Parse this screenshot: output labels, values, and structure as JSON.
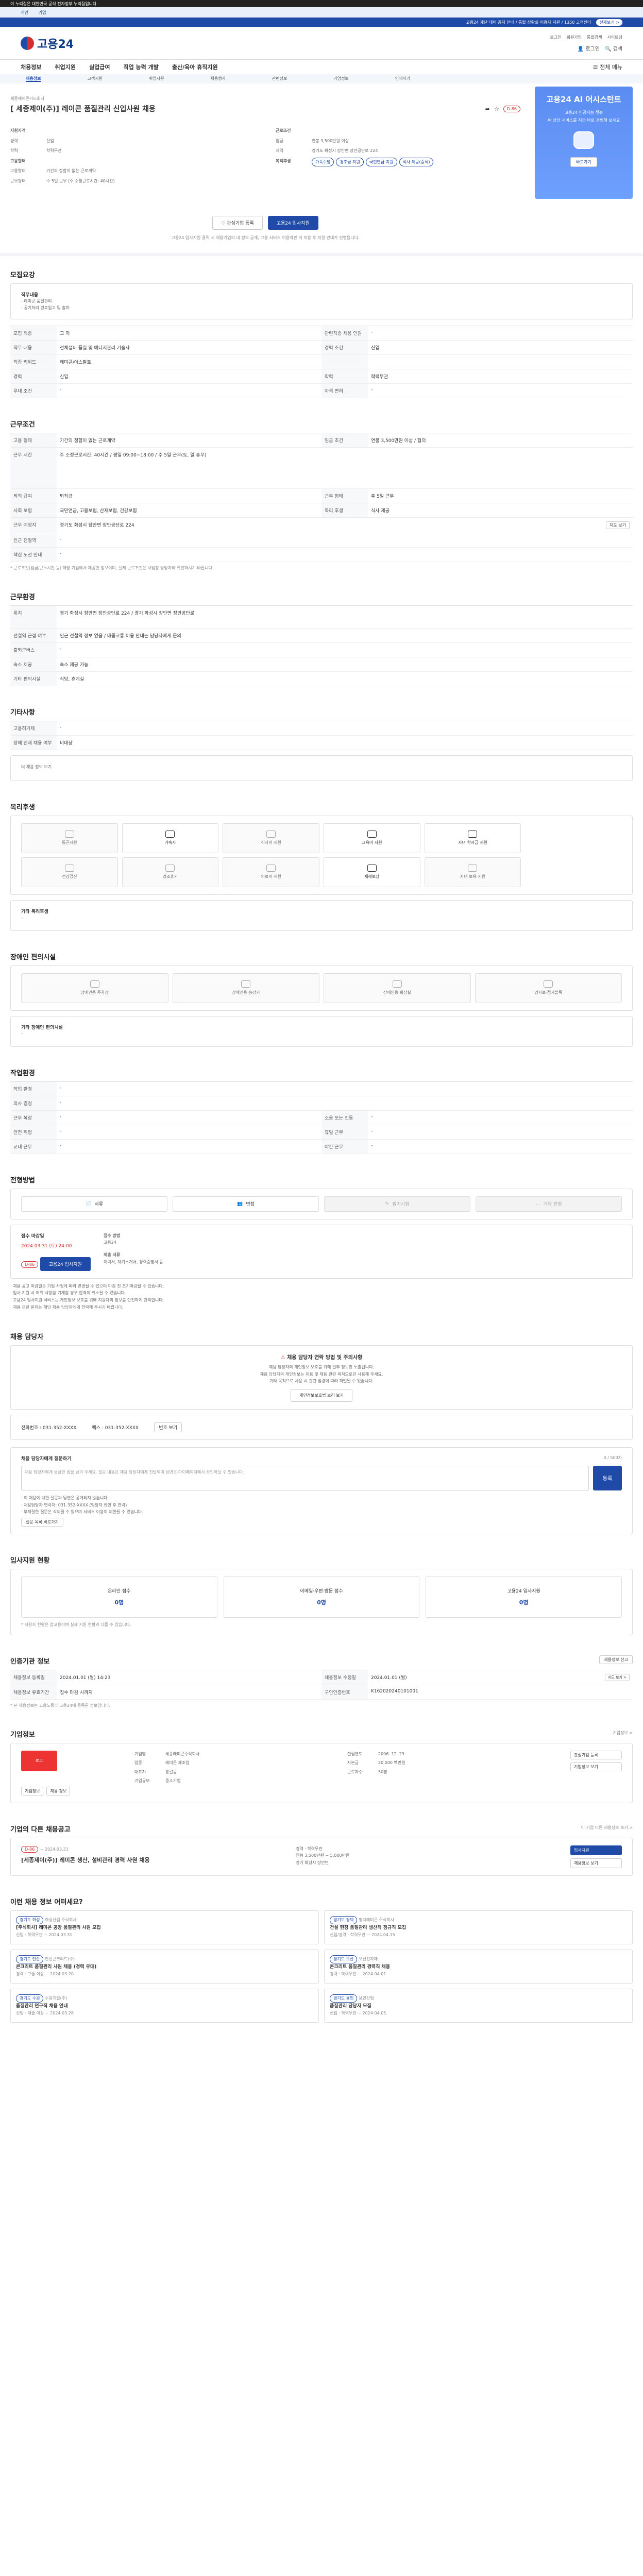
{
  "topbar": {
    "text": "이 누리집은 대한민국 공식 전자정부 누리집입니다."
  },
  "gov_links": [
    "개인",
    "기업"
  ],
  "alert": {
    "text": "고용24 재난 대비 공지 안내 / 통합 상황실 이용자 지원 / 1350 고객센터",
    "btn": "전체보기 >"
  },
  "header": {
    "logo": "고용24",
    "util": [
      "로그인",
      "회원가입",
      "통합검색",
      "사이트맵"
    ],
    "login": "로그인",
    "search": "검색"
  },
  "gnb": {
    "items": [
      "채용정보",
      "취업지원",
      "실업급여",
      "직업 능력 개발",
      "출산/육아 휴직지원"
    ],
    "right": "전체 메뉴"
  },
  "subnav": {
    "items": [
      "채용정보",
      "고객지원",
      "취업지원",
      "채용행사",
      "관련정보",
      "기업정보",
      "인쇄하기"
    ]
  },
  "job": {
    "company": "세종에이콘카드회사",
    "title": "[ 세종제이(주)] 레이콘 품질관리 신입사원 채용",
    "dday": "D-86",
    "meta_left": [
      {
        "k": "지원자격",
        "v": ""
      },
      {
        "k": "경력",
        "v": "신입"
      },
      {
        "k": "학력",
        "v": "학력무관"
      },
      {
        "k": "고용형태",
        "v": ""
      },
      {
        "k": "고용형태",
        "v": "기간의 정함이 없는 근로계약"
      },
      {
        "k": "근무형태",
        "v": "주 5일 근무 (주 소정근로시간: 40시간)"
      }
    ],
    "meta_right": [
      {
        "k": "근로조건",
        "v": ""
      },
      {
        "k": "임금",
        "v": "연봉 3,500만원 이상"
      },
      {
        "k": "지역",
        "v": "경기도 화성시 장안면 장안공단로 224"
      },
      {
        "k": "복리후생",
        "v": ""
      }
    ],
    "welfare_tags": [
      "가족수당",
      "경조금 지원",
      "국민연금 지원",
      "식사 제공(중식)"
    ],
    "btn_interest": "관심기업 등록",
    "btn_apply": "고용24 입사지원",
    "apply_note": "고용24 입사지원 클릭 시 채용기업의 내 정보 공개, 고용 서비스 이용약관 이 적용 후 지원 안내가 진행됩니다."
  },
  "side_banner": {
    "title": "고용24 AI 어시스턴트",
    "line1": "고용24 인공지능 챗봇",
    "line2": "AI 상담 서비스를 지금 바로 경험해 보세요",
    "btn": "바로가기"
  },
  "recruit": {
    "heading": "모집요강",
    "duty_title": "직무내용",
    "duties": [
      "- 레미콘 품질관리",
      "- 공기처리 원료입고 및 출하"
    ],
    "rows": [
      [
        "모집 직종",
        "그 외",
        "관련직종 채용 인원",
        "-"
      ],
      [
        "직무 내용",
        "전체설비 품질 및 에너지관리 기술사",
        "경력 조건",
        "신입"
      ],
      [
        "직종 키워드",
        "레미콘/아스팔트",
        "",
        ""
      ],
      [
        "경력",
        "신입",
        "학력",
        "학력무관"
      ],
      [
        "우대 조건",
        "-",
        "자격 면허",
        "-"
      ]
    ]
  },
  "workcond": {
    "heading": "근무조건",
    "rows": [
      [
        "고용 형태",
        "기간의 정함이 없는 근로계약",
        "임금 조건",
        "연봉 3,500만원 이상 / 협의"
      ],
      [
        "근무 시간",
        "주 소정근로시간: 40시간 / 평일 09:00~18:00 / 주 5일 근무(토, 일 휴무)",
        "",
        ""
      ],
      [
        "퇴직 급여",
        "퇴직금",
        "근무 형태",
        "주 5일 근무"
      ],
      [
        "사회 보험",
        "국민연금, 고용보험, 산재보험, 건강보험",
        "복리 후생",
        "식사 제공"
      ],
      [
        "근무 예정지",
        "경기도 화성시 장안면 장안공단로 224",
        "",
        ""
      ],
      [
        "인근 전철역",
        "-",
        "",
        ""
      ],
      [
        "핵심 노선 안내",
        "-",
        "",
        ""
      ]
    ],
    "note": "* 근로조건(임금/근무시간 등) 해당 기업에서 제공한 정보이며, 실제 근로조건은 사업장 담당자와 확인하시기 바랍니다.",
    "map_btn": "지도 보기"
  },
  "location": {
    "heading": "근무환경",
    "rows": [
      [
        "위치",
        "경기 화성시 장안면 장안공단로 224 / 경기 화성시 장안면 장안공단로"
      ],
      [
        "전철역 근접 여부",
        "인근 전철역 정보 없음 / 대중교통 이용 안내는 담당자에게 문의"
      ],
      [
        "출퇴근버스",
        "-"
      ],
      [
        "숙소 제공",
        "숙소 제공 가능"
      ],
      [
        "기타 편의시설",
        "식당, 휴게실"
      ]
    ]
  },
  "etc": {
    "heading": "기타사항",
    "rows": [
      [
        "고용허가제",
        "-"
      ],
      [
        "장애 인재 채용 여부",
        "비대상"
      ]
    ],
    "link": "더 채용 정보 보기"
  },
  "welfare_sec": {
    "heading": "복리후생",
    "items": [
      "통근지원",
      "기숙사",
      "식사비 지원",
      "교육비 지원",
      "자녀 학자금 지원",
      "건강검진",
      "경조휴가",
      "의료비 지원",
      "재해보상",
      "자녀 보육 지원"
    ],
    "other_title": "기타 복리후생",
    "other_value": "-"
  },
  "accessibility": {
    "heading": "장애인 편의시설",
    "items": [
      "장애인용 주차장",
      "장애인용 승강기",
      "장애인용 화장실",
      "경사로·점자블록"
    ],
    "other_title": "기타 장애인 편의시설",
    "other_value": "-"
  },
  "workplace": {
    "heading": "작업환경",
    "rows": [
      [
        "작업 환경",
        "-",
        "",
        ""
      ],
      [
        "의사 결정",
        "-",
        "",
        ""
      ],
      [
        "근무 복장",
        "-",
        "소음 또는 진동",
        "-"
      ],
      [
        "안전 위험",
        "-",
        "휴일 근무",
        "-"
      ],
      [
        "교대 근무",
        "-",
        "야간 근무",
        "-"
      ]
    ]
  },
  "process": {
    "heading": "전형방법",
    "steps": [
      "서류",
      "면접",
      "필기시험",
      "기타 전형"
    ],
    "apply_dead_title": "접수 마감일",
    "apply_dead": "2024.03.31 (토) 24:00",
    "dday": "D-86",
    "method_title": "접수 방법",
    "method": "고용24",
    "doc_title": "제출 서류",
    "doc": "이력서, 자기소개서, 경력증명서 등",
    "btn_apply": "고용24 입사지원",
    "notes": [
      "· 채용 공고 마감일은 기업 사정에 따라 변경될 수 있으며 마감 전 조기마감될 수 있습니다.",
      "· 입사 지원 시 허위 사항을 기재할 경우 합격이 취소될 수 있습니다.",
      "· 고용24 입사지원 서비스는 개인정보 보호를 위해 지원자의 정보를 안전하게 관리합니다.",
      "· 채용 관련 문의는 해당 채용 담당자에게 연락해 주시기 바랍니다."
    ]
  },
  "contact": {
    "heading": "채용 담당자",
    "warn_title": "채용 담당자 연락 방법 및 주의사항",
    "warn_lines": [
      "채용 담당자의 개인정보 보호를 위해 일부 정보만 노출됩니다.",
      "채용 담당자의 개인정보는 채용 및 채용 관련 목적으로만 사용해 주세요.",
      "기타 목적으로 사용 시 관련 법령에 따라 처벌될 수 있습니다."
    ],
    "warn_btn": "개인정보보호법 보러 보기",
    "phone_label": "전화번호 : 031-352-XXXX",
    "fax_label": "팩스 : 031-352-XXXX",
    "phone_btn": "번호 보기",
    "inquiry_title": "채용 담당자에게 질문하기",
    "inquiry_placeholder": "채용 담당자에게 궁금한 점을 남겨 주세요. 질문 내용은 채용 담당자에게 전달되며 답변은 마이페이지에서 확인하실 수 있습니다.",
    "inquiry_count": "0 / 500자",
    "inquiry_btn": "등록",
    "inquiry_notes": [
      "· 이 채용에 대한 질문과 답변은 공개되지 않습니다.",
      "· 채용담당자 연락처: 031-352-XXXX (담당자 확인 후 연락)",
      "· 부적절한 질문은 삭제될 수 있으며 서비스 이용이 제한될 수 있습니다."
    ],
    "inquiry_link": "질문 목록 바로가기"
  },
  "applicants": {
    "heading": "입사지원 현황",
    "boxes": [
      {
        "label": "온라인 접수",
        "value": "0명"
      },
      {
        "label": "이메일·우편·방문 접수",
        "value": "0명"
      },
      {
        "label": "고용24 입사지원",
        "value": "0명"
      }
    ],
    "note": "* 지원자 현황은 참고용이며 실제 지원 현황과 다를 수 있습니다."
  },
  "info": {
    "heading": "인증기관 정보",
    "btn": "채용정보 신고",
    "rows": [
      [
        "채용정보 등록일",
        "2024.01.01 (월) 14:23",
        "채용정보 수정일",
        "2024.01.01 (월)"
      ],
      [
        "채용정보 유효기간",
        "접수 마감 시까지",
        "구인인증번호",
        "K162020240101001"
      ]
    ],
    "btn_small": "지도 보기 >",
    "note": "* 본 채용정보는 고용노동부 고용24에 등록된 정보입니다."
  },
  "company": {
    "heading": "기업정보",
    "more": "기업정보 >",
    "name_tag": "로고",
    "rows": [
      [
        "기업명",
        "세종레미콘주식회사",
        "설립연도",
        "2006. 12. 29"
      ],
      [
        "업종",
        "레미콘 제조업",
        "자본금",
        "20,000 백만원"
      ],
      [
        "대표자",
        "홍길동",
        "근로자수",
        "50명"
      ],
      [
        "기업규모",
        "중소기업",
        "",
        ""
      ]
    ],
    "btns": [
      "관심기업 등록",
      "기업정보 보기"
    ],
    "subbtns": [
      "기업정보",
      "채용 정보"
    ]
  },
  "same_company": {
    "heading": "기업의 다른 채용공고",
    "more": "이 기업 다른 채용정보 보기 >",
    "item": {
      "tag": "D-86",
      "date": "~ 2024.03.31",
      "title": "[세종제이(주)] 레미콘 생산, 설비관리 경력 사원 채용",
      "cond1": "경력",
      "cond2": "학력무관",
      "pay": "연봉 3,500만원 ~ 5,000만원",
      "loc": "경기 화성시 장안면",
      "btn1": "입사지원",
      "btn2": "채용정보 보기"
    }
  },
  "similar": {
    "heading": "이런 채용 정보 어떠세요?",
    "items": [
      {
        "tag": "경기도 화성",
        "company": "화성산업 주식회사",
        "title": "[주식회사] 레미콘 공장 품질관리 사원 모집",
        "meta": "신입 · 학력무관",
        "date": "~ 2024.03.31"
      },
      {
        "tag": "경기도 평택",
        "company": "평택레미콘 주식회사",
        "title": "건설 현장 품질관리 생산직 정규직 모집",
        "meta": "신입/경력 · 학력무관",
        "date": "~ 2024.04.15"
      },
      {
        "tag": "경기도 안산",
        "company": "안산콘크리트(주)",
        "title": "콘크리트 품질관리 사원 채용 (경력 우대)",
        "meta": "경력 · 고졸 이상",
        "date": "~ 2024.03.20"
      },
      {
        "tag": "경기도 오산",
        "company": "오산건자재",
        "title": "콘크리트 품질관리 경력직 채용",
        "meta": "경력 · 학력무관",
        "date": "~ 2024.04.01"
      },
      {
        "tag": "경기도 수원",
        "company": "수원개발(주)",
        "title": "품질관리 연구직 채용 안내",
        "meta": "신입 · 대졸 이상",
        "date": "~ 2024.03.28"
      },
      {
        "tag": "경기도 용인",
        "company": "용인산업",
        "title": "품질관리 담당자 모집",
        "meta": "신입 · 학력무관",
        "date": "~ 2024.04.05"
      }
    ]
  }
}
